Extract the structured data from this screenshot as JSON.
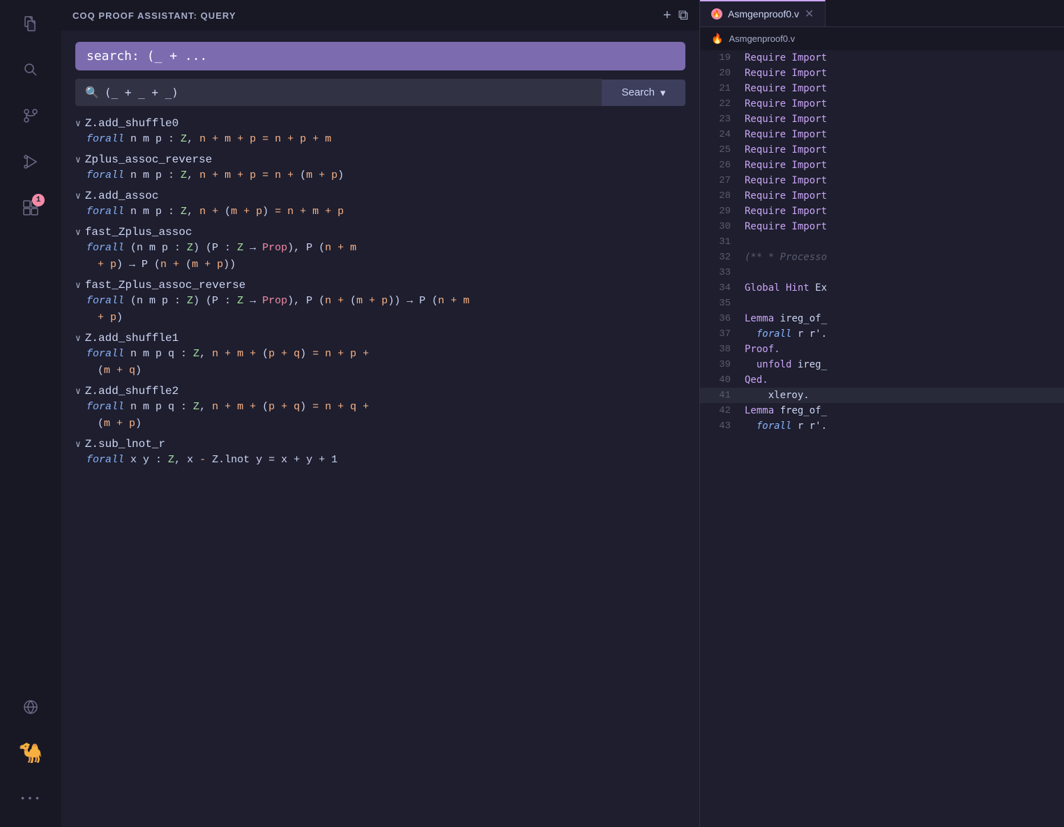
{
  "activityBar": {
    "icons": [
      {
        "name": "files-icon",
        "symbol": "⧉",
        "active": false
      },
      {
        "name": "search-icon",
        "symbol": "🔍",
        "active": false
      },
      {
        "name": "source-control-icon",
        "symbol": "⎇",
        "active": false
      },
      {
        "name": "run-debug-icon",
        "symbol": "▶",
        "active": false
      },
      {
        "name": "extensions-icon",
        "symbol": "⊞",
        "active": false,
        "badge": "1"
      }
    ],
    "bottomIcons": [
      {
        "name": "remote-icon",
        "symbol": "↻"
      },
      {
        "name": "coq-icon",
        "symbol": "🐪"
      },
      {
        "name": "more-icon",
        "symbol": "•••"
      }
    ]
  },
  "queryPanel": {
    "title": "COQ PROOF ASSISTANT: QUERY",
    "addIcon": "+",
    "splitIcon": "⧉",
    "searchPill": "search: (_ + ...",
    "searchInput": "(_ + _ + _)",
    "searchPlaceholder": "(_ + _ + _)",
    "searchButtonLabel": "Search",
    "results": [
      {
        "name": "Z.add_shuffle0",
        "formula": "forall n m p : Z, n + m + p = n + p + m"
      },
      {
        "name": "Zplus_assoc_reverse",
        "formula": "forall n m p : Z, n + m + p = n + (m + p)"
      },
      {
        "name": "Z.add_assoc",
        "formula": "forall n m p : Z, n + (m + p) = n + m + p"
      },
      {
        "name": "fast_Zplus_assoc",
        "formula": "forall (n m p : Z) (P : Z → Prop), P (n + m + p) → P (n + (m + p))"
      },
      {
        "name": "fast_Zplus_assoc_reverse",
        "formula": "forall (n m p : Z) (P : Z → Prop), P (n + (m + p)) → P (n + m + p)"
      },
      {
        "name": "Z.add_shuffle1",
        "formula": "forall n m p q : Z, n + m + (p + q) = n + p + (m + q)"
      },
      {
        "name": "Z.add_shuffle2",
        "formula": "forall n m p q : Z, n + m + (p + q) = n + q + (m + p)"
      },
      {
        "name": "Z.sub_lnot_r",
        "formula": "forall x y : Z, x - Z.lnot y = x + y + 1"
      }
    ]
  },
  "editorPanel": {
    "tab": {
      "label": "Asmgenproof0.v",
      "secondaryLabel": "Asmgenproof0.v"
    },
    "lines": [
      {
        "num": 19,
        "code": "Require Import"
      },
      {
        "num": 20,
        "code": "Require Import"
      },
      {
        "num": 21,
        "code": "Require Import"
      },
      {
        "num": 22,
        "code": "Require Import"
      },
      {
        "num": 23,
        "code": "Require Import"
      },
      {
        "num": 24,
        "code": "Require Import"
      },
      {
        "num": 25,
        "code": "Require Import"
      },
      {
        "num": 26,
        "code": "Require Import"
      },
      {
        "num": 27,
        "code": "Require Import"
      },
      {
        "num": 28,
        "code": "Require Import"
      },
      {
        "num": 29,
        "code": "Require Import"
      },
      {
        "num": 30,
        "code": "Require Import"
      },
      {
        "num": 31,
        "code": ""
      },
      {
        "num": 32,
        "code": "(** * Processo"
      },
      {
        "num": 33,
        "code": ""
      },
      {
        "num": 34,
        "code": "Global Hint Ex"
      },
      {
        "num": 35,
        "code": ""
      },
      {
        "num": 36,
        "code": "Lemma ireg_of_"
      },
      {
        "num": 37,
        "code": "  forall r r'."
      },
      {
        "num": 38,
        "code": "Proof."
      },
      {
        "num": 39,
        "code": "  unfold ireg_"
      },
      {
        "num": 40,
        "code": "Qed."
      },
      {
        "num": 41,
        "code": "  xleroy."
      },
      {
        "num": 42,
        "code": "Lemma freg_of_"
      },
      {
        "num": 43,
        "code": "  forall r r'."
      }
    ]
  }
}
